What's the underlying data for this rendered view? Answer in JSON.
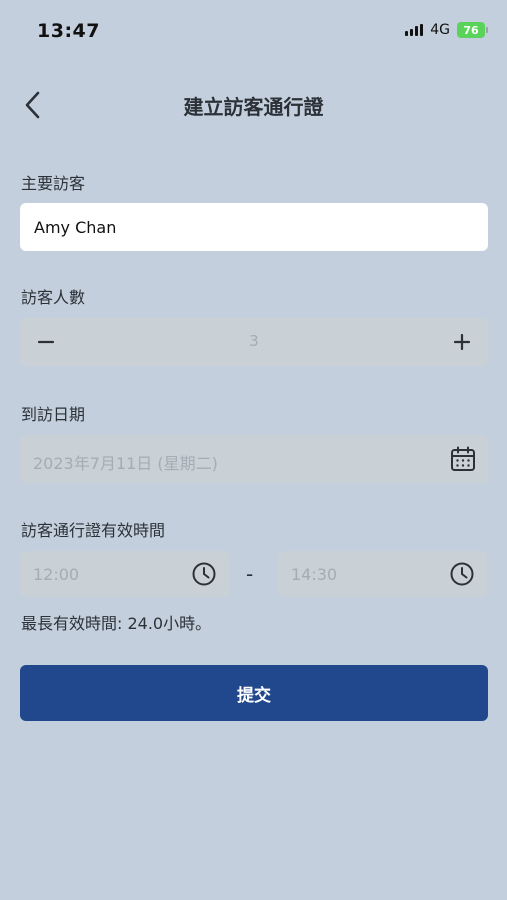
{
  "status_bar": {
    "time": "13:47",
    "network": "4G",
    "battery": "76"
  },
  "header": {
    "title": "建立訪客通行證"
  },
  "form": {
    "primary_visitor": {
      "label": "主要訪客",
      "value": "Amy Chan"
    },
    "visitor_count": {
      "label": "訪客人數",
      "value": "3",
      "decrement": "−",
      "increment": "+"
    },
    "visit_date": {
      "label": "到訪日期",
      "value": "2023年7月11日 (星期二)"
    },
    "validity": {
      "label": "訪客通行證有效時間",
      "start_time": "12:00",
      "separator": "-",
      "end_time": "14:30",
      "max_hint": "最長有效時間: 24.0小時。"
    }
  },
  "actions": {
    "submit_label": "提交"
  },
  "colors": {
    "background": "#c3cfdc",
    "primary": "#21488c",
    "field_disabled": "#c9d0d6",
    "battery": "#5ad35a"
  }
}
